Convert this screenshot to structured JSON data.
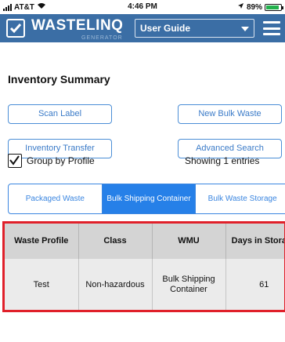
{
  "status_bar": {
    "carrier": "AT&T",
    "time": "4:46 PM",
    "battery": "89%",
    "battery_level": 0.89
  },
  "header": {
    "logo_text": "WASTELINQ",
    "logo_subtext": "GENERATOR",
    "guide_selected": "User Guide",
    "colors": {
      "bar": "#3b6ea5",
      "accent": "#2680e8",
      "highlight": "#e0202a"
    }
  },
  "page": {
    "title": "Inventory Summary"
  },
  "actions": {
    "scan_label": "Scan Label",
    "new_bulk_waste": "New Bulk Waste",
    "inventory_transfer": "Inventory Transfer",
    "advanced_search": "Advanced Search"
  },
  "filters": {
    "group_by_profile_label": "Group by Profile",
    "group_by_profile_checked": true,
    "showing_text": "Showing 1 entries"
  },
  "tabs": [
    {
      "label": "Packaged Waste",
      "active": false
    },
    {
      "label": "Bulk Shipping Container",
      "active": true
    },
    {
      "label": "Bulk Waste Storage",
      "active": false
    }
  ],
  "table": {
    "headers": [
      "Waste Profile",
      "Class",
      "WMU",
      "Days in Storage"
    ],
    "rows": [
      [
        "Test",
        "Non-hazardous",
        "Bulk Shipping Container",
        "61"
      ]
    ]
  },
  "icons": {
    "signal": "signal-icon",
    "wifi": "wifi-icon",
    "location": "location-icon",
    "battery": "battery-icon",
    "logo": "check-square-icon",
    "dropdown": "chevron-down-icon",
    "menu": "hamburger-menu-icon",
    "checkbox": "check-icon"
  }
}
